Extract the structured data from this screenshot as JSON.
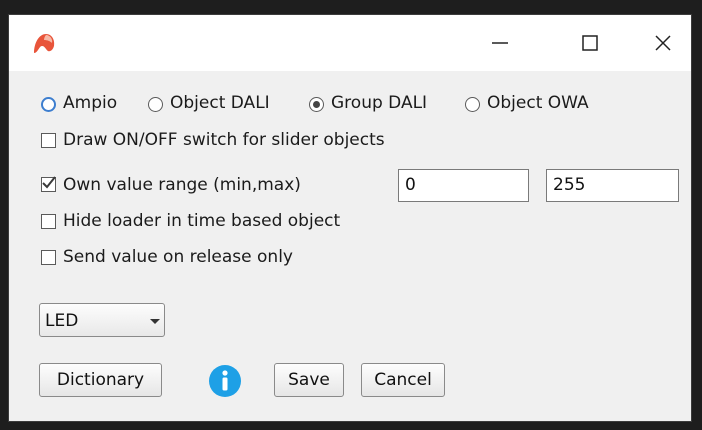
{
  "titlebar": {
    "app_icon": "ampio-logo-icon",
    "controls": [
      "minimize-icon",
      "maximize-icon",
      "close-icon"
    ]
  },
  "radios": [
    {
      "label": "Ampio",
      "checked": false
    },
    {
      "label": "Object DALI",
      "checked": false
    },
    {
      "label": "Group DALI",
      "checked": true
    },
    {
      "label": "Object OWA",
      "checked": false
    }
  ],
  "options": {
    "draw_switch": {
      "label": "Draw ON/OFF switch for slider objects",
      "checked": false
    },
    "own_range": {
      "label": "Own value range (min,max)",
      "checked": true,
      "min": "0",
      "max": "255"
    },
    "hide_loader": {
      "label": "Hide loader in time based object",
      "checked": false
    },
    "send_on_release": {
      "label": "Send value on release only",
      "checked": false
    }
  },
  "type_select": {
    "value": "LED"
  },
  "buttons": {
    "dictionary": "Dictionary",
    "save": "Save",
    "cancel": "Cancel"
  },
  "colors": {
    "accent": "#3d7ecf",
    "info": "#1ea0e6",
    "brand": "#e8543a"
  }
}
